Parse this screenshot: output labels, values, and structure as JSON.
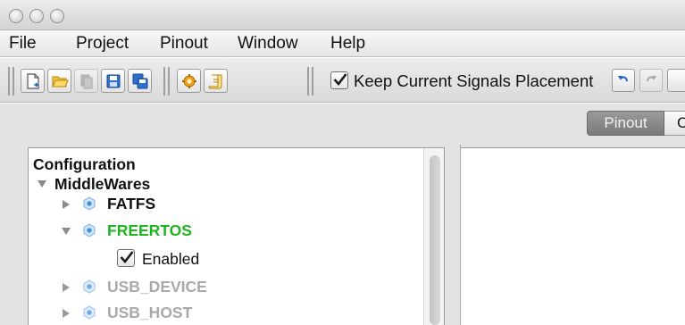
{
  "menu": {
    "items": [
      "File",
      "Project",
      "Pinout",
      "Window",
      "Help"
    ]
  },
  "toolbar": {
    "buttons": [
      {
        "icon": "new-project-icon",
        "enabled": true
      },
      {
        "icon": "open-folder-icon",
        "enabled": true
      },
      {
        "icon": "copy-document-icon",
        "enabled": false
      },
      {
        "icon": "save-icon",
        "enabled": true
      },
      {
        "icon": "save-as-icon",
        "enabled": true
      },
      {
        "icon": "generate-code-icon",
        "enabled": true
      },
      {
        "icon": "report-scroll-icon",
        "enabled": true
      }
    ],
    "keep_signals": {
      "label": "Keep Current Signals Placement",
      "checked": true
    },
    "undo_icon": "undo-icon",
    "redo_icon": "redo-icon"
  },
  "tabs": {
    "active": "Pinout",
    "next_partial": "C"
  },
  "tree": {
    "root": "Configuration",
    "group": "MiddleWares",
    "items": [
      {
        "label": "FATFS",
        "expanded": false,
        "state": "normal"
      },
      {
        "label": "FREERTOS",
        "expanded": true,
        "state": "active"
      },
      {
        "label": "USB_DEVICE",
        "expanded": false,
        "state": "disabled"
      },
      {
        "label": "USB_HOST",
        "expanded": false,
        "state": "disabled"
      }
    ],
    "freertos_option": {
      "label": "Enabled",
      "checked": true
    }
  },
  "colors": {
    "active_green": "#1fb51f",
    "disabled_grey": "#a9a9a9",
    "node_blue": "#3f8fd9",
    "tab_selected": "#8a8a8a"
  }
}
